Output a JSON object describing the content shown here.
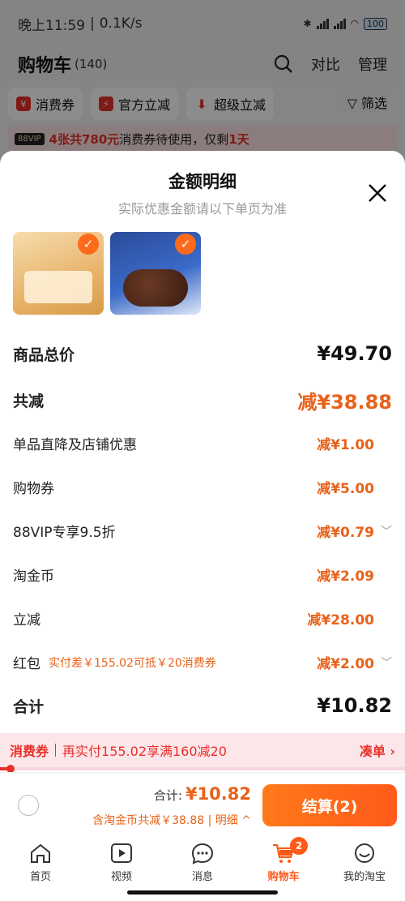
{
  "status": {
    "time": "晚上11:59",
    "speed": "0.1K/s",
    "battery": "100"
  },
  "header": {
    "title": "购物车",
    "count": "(140)",
    "compare": "对比",
    "manage": "管理"
  },
  "chips": [
    "消费券",
    "官方立减",
    "超级立减",
    "筛选"
  ],
  "banner": {
    "vip": "88VIP",
    "highlight": "4张共780元",
    "text": "消费券待使用，仅剩",
    "days": "1天"
  },
  "sheet": {
    "title": "金额明细",
    "subtitle": "实际优惠金额请以下单页为准",
    "rows": [
      {
        "label": "商品总价",
        "value": "¥49.70",
        "note": ""
      },
      {
        "label": "共减",
        "value": "减¥38.88",
        "note": ""
      },
      {
        "label": "单品直降及店铺优惠",
        "value": "减¥1.00",
        "note": ""
      },
      {
        "label": "购物券",
        "value": "减¥5.00",
        "note": ""
      },
      {
        "label": "88VIP专享9.5折",
        "value": "减¥0.79",
        "note": ""
      },
      {
        "label": "淘金币",
        "value": "减¥2.09",
        "note": ""
      },
      {
        "label": "立减",
        "value": "减¥28.00",
        "note": ""
      },
      {
        "label": "红包",
        "value": "减¥2.00",
        "note": "实付差￥155.02可抵￥20消费券"
      },
      {
        "label": "合计",
        "value": "¥10.82",
        "note": ""
      }
    ]
  },
  "promo": {
    "tag": "消费券",
    "text": "再实付155.02享满160减20",
    "action": "凑单 ›",
    "progress": 0.02
  },
  "checkout": {
    "total_label": "合计:",
    "total": "¥10.82",
    "subline": "含淘金币共减￥38.88 | 明细 ^",
    "button": "结算(2)"
  },
  "tabs": [
    {
      "label": "首页",
      "icon": "home-icon"
    },
    {
      "label": "视频",
      "icon": "video-icon"
    },
    {
      "label": "消息",
      "icon": "message-icon"
    },
    {
      "label": "购物车",
      "icon": "cart-icon",
      "badge": "2"
    },
    {
      "label": "我的淘宝",
      "icon": "profile-icon"
    }
  ],
  "colors": {
    "accent": "#ff5a1a",
    "red": "#e8302a"
  }
}
